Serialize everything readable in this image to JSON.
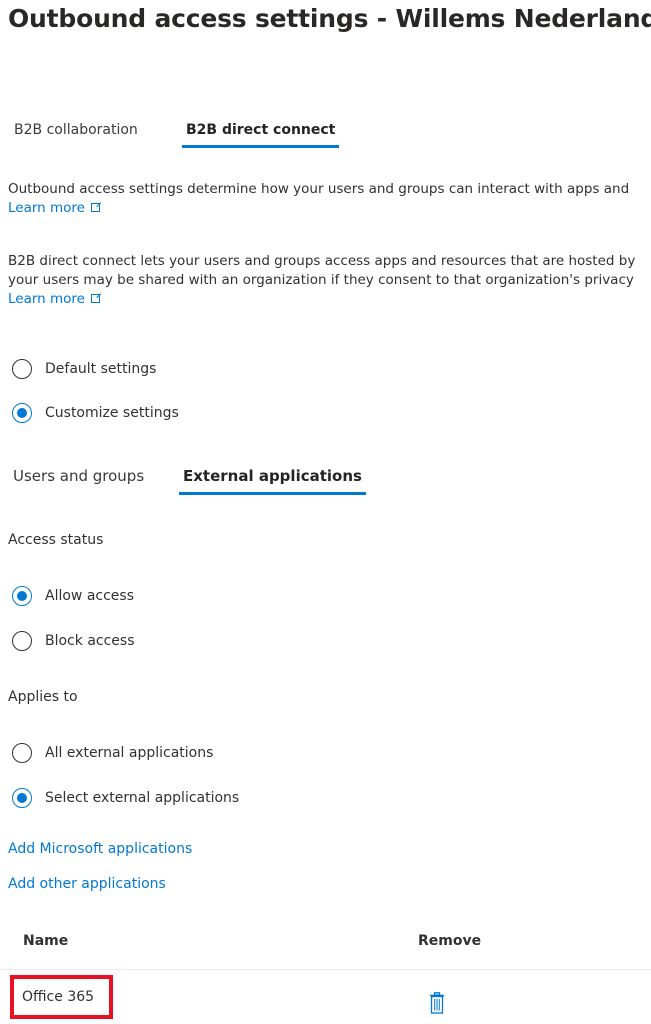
{
  "page": {
    "title": "Outbound access settings - Willems Nederland"
  },
  "top_tabs": [
    {
      "label": "B2B collaboration",
      "active": false
    },
    {
      "label": "B2B direct connect",
      "active": true
    }
  ],
  "intro": {
    "text": "Outbound access settings determine how your users and groups can interact with apps and",
    "learn_more": "Learn more"
  },
  "direct_connect_info": {
    "line1": "B2B direct connect lets your users and groups access apps and resources that are hosted by",
    "line2": "your users may be shared with an organization if they consent to that organization's privacy",
    "learn_more": "Learn more"
  },
  "settings_mode": {
    "options": [
      {
        "label": "Default settings",
        "checked": false
      },
      {
        "label": "Customize settings",
        "checked": true
      }
    ]
  },
  "sub_tabs": [
    {
      "label": "Users and groups",
      "active": false
    },
    {
      "label": "External applications",
      "active": true
    }
  ],
  "access_status": {
    "label": "Access status",
    "options": [
      {
        "label": "Allow access",
        "checked": true
      },
      {
        "label": "Block access",
        "checked": false
      }
    ]
  },
  "applies_to": {
    "label": "Applies to",
    "options": [
      {
        "label": "All external applications",
        "checked": false
      },
      {
        "label": "Select external applications",
        "checked": true
      }
    ]
  },
  "actions": {
    "add_microsoft": "Add Microsoft applications",
    "add_other": "Add other applications"
  },
  "table": {
    "columns": [
      "Name",
      "Remove"
    ],
    "rows": [
      {
        "name": "Office 365",
        "remove_icon": "trash-icon"
      }
    ]
  },
  "colors": {
    "accent": "#0078d4",
    "highlight_box": "#e81123"
  }
}
